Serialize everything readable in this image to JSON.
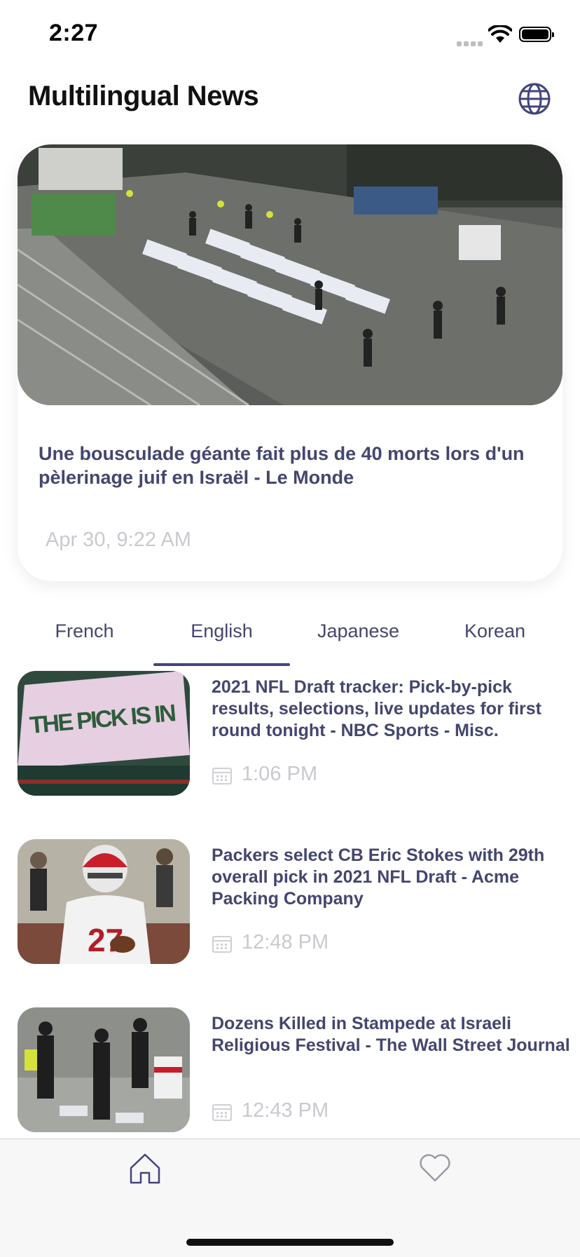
{
  "status": {
    "time": "2:27"
  },
  "header": {
    "title": "Multilingual News"
  },
  "hero": {
    "title": "Une bousculade géante fait plus de 40 morts lors d'un pèlerinage juif en Israël - Le Monde",
    "date": "Apr 30, 9:22 AM"
  },
  "tabs": [
    {
      "label": "French"
    },
    {
      "label": "English",
      "selected": true
    },
    {
      "label": "Japanese"
    },
    {
      "label": "Korean"
    }
  ],
  "articles": [
    {
      "title": "2021 NFL Draft tracker: Pick-by-pick results, selections, live updates for first round tonight - NBC Sports - Misc.",
      "time": "1:06 PM",
      "thumb_text": "THE PICK IS IN"
    },
    {
      "title": "Packers select CB Eric Stokes with 29th overall pick in 2021 NFL Draft - Acme Packing Company",
      "time": "12:48 PM"
    },
    {
      "title": "Dozens Killed in Stampede at Israeli Religious Festival - The Wall Street Journal",
      "time": "12:43 PM"
    }
  ],
  "bottom_nav": {
    "items": [
      {
        "icon": "home-icon",
        "selected": true
      },
      {
        "icon": "heart-icon"
      }
    ]
  },
  "colors": {
    "accent": "#43457a",
    "muted": "#c9c9cf"
  }
}
